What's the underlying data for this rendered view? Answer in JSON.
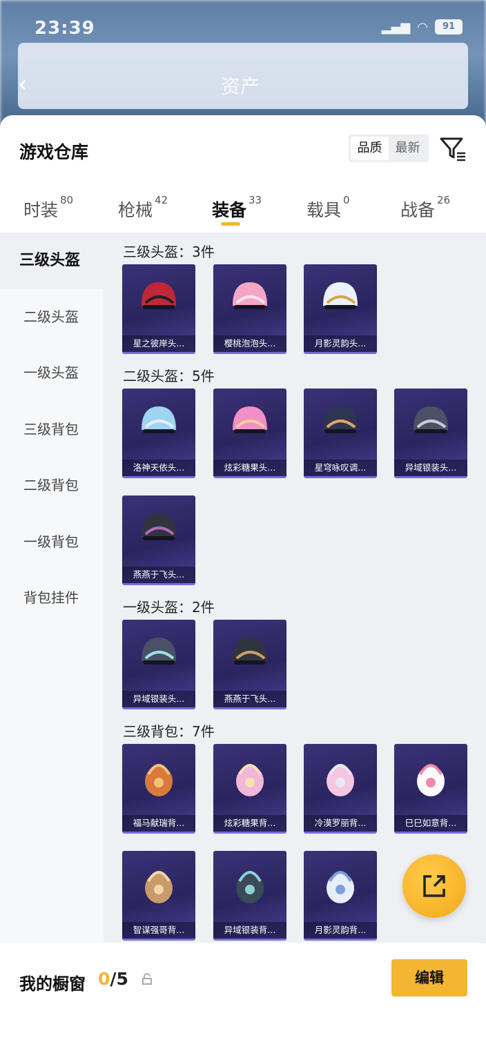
{
  "status_bar": {
    "time": "23:39",
    "battery": "91"
  },
  "background": {
    "title": "资产"
  },
  "header": {
    "title": "游戏仓库",
    "sort_options": [
      "品质",
      "最新"
    ]
  },
  "tabs": [
    {
      "label": "时装",
      "count": "80"
    },
    {
      "label": "枪械",
      "count": "42"
    },
    {
      "label": "装备",
      "count": "33"
    },
    {
      "label": "载具",
      "count": "0"
    },
    {
      "label": "战备",
      "count": "26"
    }
  ],
  "sidebar": {
    "items": [
      "三级头盔",
      "二级头盔",
      "一级头盔",
      "三级背包",
      "二级背包",
      "一级背包",
      "背包挂件"
    ]
  },
  "sections": [
    {
      "title": "三级头盔：3件",
      "items": [
        "星之彼岸头...",
        "樱桃泡泡头...",
        "月影灵韵头..."
      ]
    },
    {
      "title": "二级头盔：5件",
      "items": [
        "洛神天依头...",
        "炫彩糖果头...",
        "星穹咏叹调...",
        "异域银装头...",
        "燕燕于飞头..."
      ]
    },
    {
      "title": "一级头盔：2件",
      "items": [
        "异域银装头...",
        "燕燕于飞头..."
      ]
    },
    {
      "title": "三级背包：7件",
      "items": [
        "福马献瑞背...",
        "炫彩糖果背...",
        "冷漠罗丽背...",
        "巳巳如意背...",
        "智谋强哥背...",
        "异域银装背...",
        "月影灵韵背..."
      ]
    }
  ],
  "bottom": {
    "label": "我的橱窗",
    "current": "0",
    "total": "/5",
    "edit_label": "编辑"
  },
  "colors": {
    "accent": "#f2b632",
    "card_bg": "#2a2560"
  }
}
